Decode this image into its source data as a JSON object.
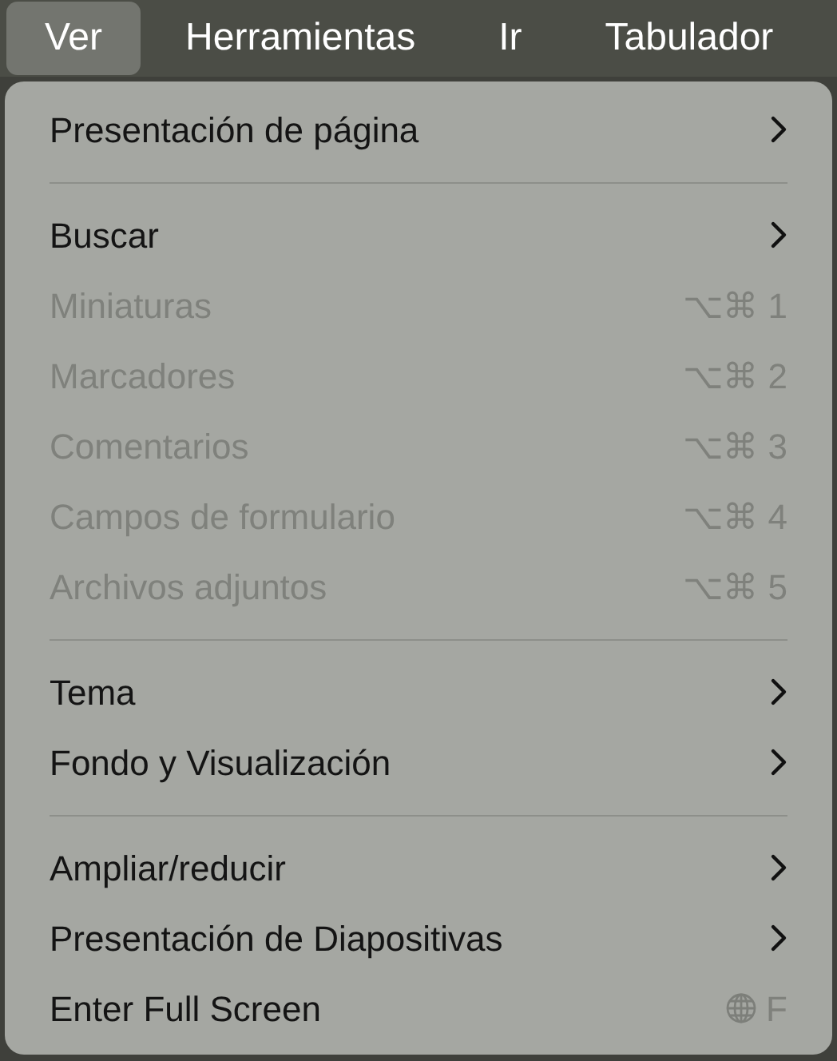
{
  "menu_bar": [
    {
      "label": "Ver",
      "selected": true
    },
    {
      "label": "Herramientas",
      "selected": false
    },
    {
      "label": "Ir",
      "selected": false
    },
    {
      "label": "Tabulador",
      "selected": false
    }
  ],
  "menu": [
    {
      "kind": "submenu",
      "label": "Presentación de página",
      "disabled": false
    },
    {
      "kind": "separator"
    },
    {
      "kind": "submenu",
      "label": "Buscar",
      "disabled": false
    },
    {
      "kind": "shortcut",
      "label": "Miniaturas",
      "disabled": true,
      "shortcut": "⌥⌘ 1"
    },
    {
      "kind": "shortcut",
      "label": "Marcadores",
      "disabled": true,
      "shortcut": "⌥⌘ 2"
    },
    {
      "kind": "shortcut",
      "label": "Comentarios",
      "disabled": true,
      "shortcut": "⌥⌘ 3"
    },
    {
      "kind": "shortcut",
      "label": "Campos de formulario",
      "disabled": true,
      "shortcut": "⌥⌘ 4"
    },
    {
      "kind": "shortcut",
      "label": "Archivos adjuntos",
      "disabled": true,
      "shortcut": "⌥⌘ 5"
    },
    {
      "kind": "separator"
    },
    {
      "kind": "submenu",
      "label": "Tema",
      "disabled": false
    },
    {
      "kind": "submenu",
      "label": "Fondo y Visualización",
      "disabled": false
    },
    {
      "kind": "separator"
    },
    {
      "kind": "submenu",
      "label": "Ampliar/reducir",
      "disabled": false
    },
    {
      "kind": "submenu",
      "label": "Presentación de Diapositivas",
      "disabled": false
    },
    {
      "kind": "globe_shortcut",
      "label": "Enter Full Screen",
      "disabled": false,
      "shortcut": "F"
    }
  ]
}
